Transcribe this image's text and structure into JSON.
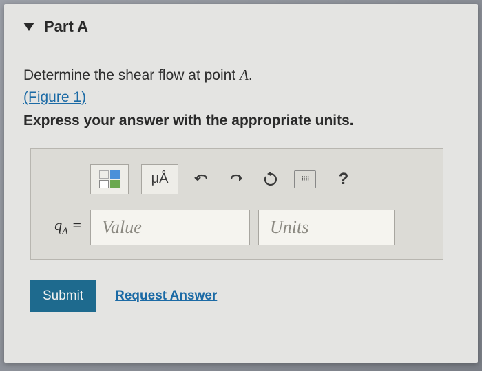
{
  "part": {
    "label": "Part A"
  },
  "prompt": {
    "text_before": "Determine the shear flow at point ",
    "point": "A",
    "text_after": "."
  },
  "figure_link": "(Figure 1)",
  "instruction": "Express your answer with the appropriate units.",
  "toolbar": {
    "symbols_label": "μÅ",
    "help_label": "?"
  },
  "answer": {
    "variable": "qA =",
    "value_placeholder": "Value",
    "units_placeholder": "Units"
  },
  "actions": {
    "submit": "Submit",
    "request": "Request Answer"
  }
}
